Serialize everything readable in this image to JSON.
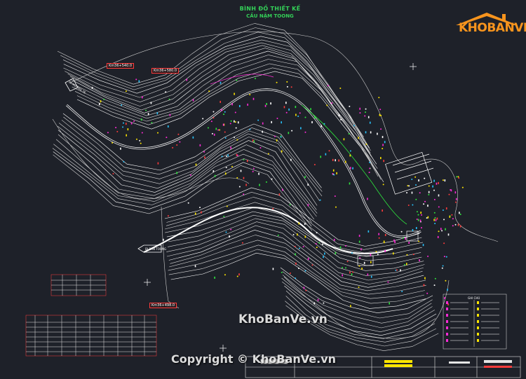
{
  "title": {
    "main": "BÌNH ĐỒ THIẾT KẾ",
    "sub": "CẦU NẬM TOONG"
  },
  "logo": {
    "text": "KHOBANVE",
    "color": "#f7941d"
  },
  "watermarks": {
    "center": "KhoBanVe.vn",
    "copyright": "Copyright © KhoBanVe.vn"
  },
  "station_tags": [
    "Km36+540.0",
    "Km36+580.0",
    "Km36+498.0"
  ],
  "direction_labels": [
    "ĐI MƯỜNG TÈ",
    "ĐI BẢN TOONG"
  ],
  "legend": {
    "title": "GHI CHÚ"
  },
  "colors": {
    "background": "#1e2129",
    "contour": "#d9d9d9",
    "accent_magenta": "#ff2bd6",
    "accent_green": "#2ee53d",
    "accent_yellow": "#ffe600",
    "accent_red": "#ff3b3b",
    "accent_cyan": "#29c4ff"
  }
}
